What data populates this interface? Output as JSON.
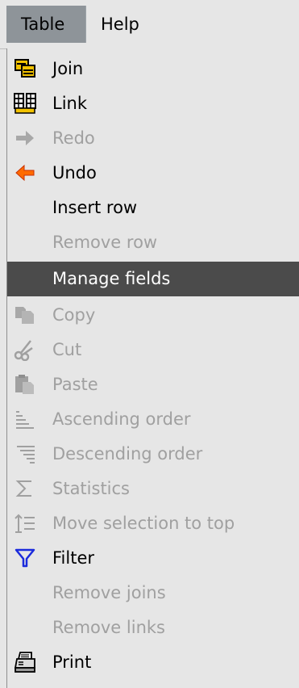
{
  "menubar": {
    "table": "Table",
    "help": "Help"
  },
  "menu": {
    "items": [
      {
        "label": "Join",
        "icon": "join-icon",
        "enabled": true
      },
      {
        "label": "Link",
        "icon": "link-icon",
        "enabled": true
      },
      {
        "label": "Redo",
        "icon": "redo-arrow-icon",
        "enabled": false
      },
      {
        "label": "Undo",
        "icon": "undo-arrow-icon",
        "enabled": true
      },
      {
        "label": "Insert row",
        "icon": "",
        "enabled": true
      },
      {
        "label": "Remove row",
        "icon": "",
        "enabled": false
      },
      {
        "label": "Manage fields",
        "icon": "",
        "enabled": true,
        "selected": true
      },
      {
        "label": "Copy",
        "icon": "copy-icon",
        "enabled": false
      },
      {
        "label": "Cut",
        "icon": "scissors-icon",
        "enabled": false
      },
      {
        "label": "Paste",
        "icon": "paste-icon",
        "enabled": false
      },
      {
        "label": "Ascending order",
        "icon": "sort-ascending-icon",
        "enabled": false
      },
      {
        "label": "Descending order",
        "icon": "sort-descending-icon",
        "enabled": false
      },
      {
        "label": "Statistics",
        "icon": "sigma-icon",
        "enabled": false
      },
      {
        "label": "Move selection to top",
        "icon": "move-to-top-icon",
        "enabled": false
      },
      {
        "label": "Filter",
        "icon": "filter-icon",
        "enabled": true
      },
      {
        "label": "Remove joins",
        "icon": "",
        "enabled": false
      },
      {
        "label": "Remove links",
        "icon": "",
        "enabled": false
      },
      {
        "label": "Print",
        "icon": "printer-icon",
        "enabled": true
      }
    ]
  },
  "colors": {
    "menu_background": "#e6e6e6",
    "active_menubar": "#8e9499",
    "selected_row": "#4b4b4b",
    "disabled_text": "#a0a0a0",
    "undo_orange": "#ff6a00",
    "filter_blue": "#1b2bdc"
  }
}
